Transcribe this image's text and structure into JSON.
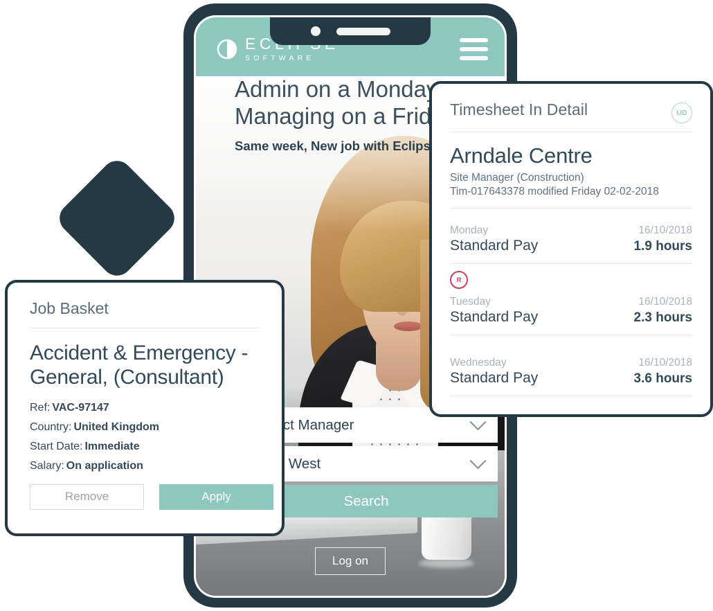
{
  "phone": {
    "appbar": {
      "logo_primary": "ECLIPSE",
      "logo_secondary": "SOFTWARE",
      "menu_icon": "hamburger-menu-icon"
    },
    "hero": {
      "title_line1": "Admin on a Monday,",
      "title_line2": "Managing on a Friday",
      "subtitle": "Same week, New job with Eclipse"
    },
    "search": {
      "job_title_value": "Project Manager",
      "location_value": "North West",
      "search_label": "Search",
      "chevron_icon": "chevron-down-icon"
    },
    "logon_label": "Log on"
  },
  "timesheet": {
    "title": "Timesheet In Detail",
    "avatar_initials": "UD",
    "site": "Arndale Centre",
    "role": "Site Manager (Construction)",
    "reference_line": "Tim-017643378  modified Friday 02-02-2018",
    "rows": [
      {
        "day": "Monday",
        "date": "16/10/2018",
        "pay_type": "Standard Pay",
        "hours": "1.9 hours",
        "badge": ""
      },
      {
        "day": "Tuesday",
        "date": "16/10/2018",
        "pay_type": "Standard Pay",
        "hours": "2.3 hours",
        "badge": "R"
      },
      {
        "day": "Wednesday",
        "date": "16/10/2018",
        "pay_type": "Standard Pay",
        "hours": "3.6 hours",
        "badge": ""
      }
    ]
  },
  "job_basket": {
    "title": "Job Basket",
    "job_title_line1": "Accident & Emergency -",
    "job_title_line2": "General, (Consultant)",
    "fields": [
      {
        "key": "Ref:",
        "value": "VAC-97147"
      },
      {
        "key": "Country:",
        "value": "United Kingdom"
      },
      {
        "key": "Start Date:",
        "value": "Immediate"
      },
      {
        "key": "Salary:",
        "value": "On application"
      }
    ],
    "remove_label": "Remove",
    "apply_label": "Apply"
  },
  "colors": {
    "brand_teal": "#8dc7bf",
    "brand_dark": "#253944",
    "text_dark": "#32495a",
    "text_muted": "#a9b4bc",
    "alert_red": "#c8415c"
  }
}
